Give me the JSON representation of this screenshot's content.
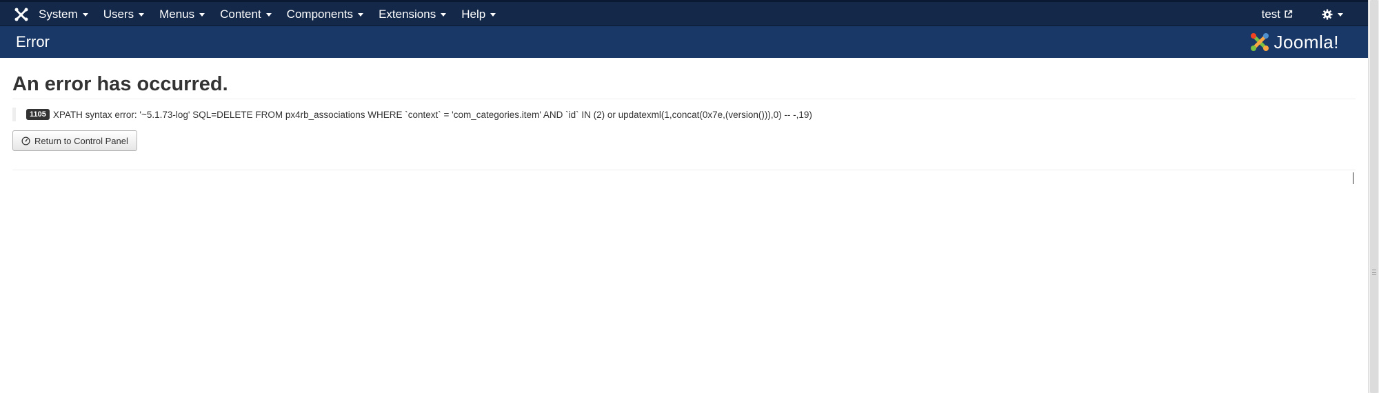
{
  "navbar": {
    "logo_icon": "joomla-logo-icon",
    "menu": [
      {
        "label": "System"
      },
      {
        "label": "Users"
      },
      {
        "label": "Menus"
      },
      {
        "label": "Content"
      },
      {
        "label": "Components"
      },
      {
        "label": "Extensions"
      },
      {
        "label": "Help"
      }
    ],
    "user_label": "test",
    "user_icon": "external-link-icon",
    "settings_icon": "gear-icon"
  },
  "header": {
    "title": "Error",
    "brand": "Joomla!"
  },
  "main": {
    "heading": "An error has occurred.",
    "error_code": "1105",
    "error_text": "XPATH syntax error: '~5.1.73-log' SQL=DELETE FROM px4rb_associations WHERE `context` = 'com_categories.item' AND `id` IN (2) or updatexml(1,concat(0x7e,(version())),0) -- -,19)",
    "return_button": "Return to Control Panel"
  },
  "colors": {
    "navbar": "#14284a",
    "header": "#1a3867",
    "badge": "#333333"
  }
}
